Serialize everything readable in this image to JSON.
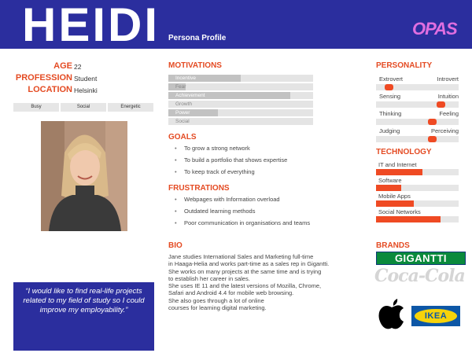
{
  "header": {
    "name": "HEIDI",
    "subtitle": "Persona Profile",
    "logo": "OPAS",
    "color": "#2b2e9e"
  },
  "facts": [
    {
      "label": "AGE",
      "value": "22"
    },
    {
      "label": "PROFESSION",
      "value": "Student"
    },
    {
      "label": "LOCATION",
      "value": "Helsinki"
    }
  ],
  "traits": [
    "Busy",
    "Social",
    "Energetic"
  ],
  "quote": "“I would like to find real-life projects related to my field of study so I could improve my employability.”",
  "motivations": {
    "title": "MOTIVATIONS",
    "items": [
      {
        "label": "Incentive",
        "level": 0.5
      },
      {
        "label": "Fear",
        "level": 0.12
      },
      {
        "label": "Achievement",
        "level": 0.84
      },
      {
        "label": "Growth",
        "level": 0.0
      },
      {
        "label": "Power",
        "level": 0.34
      },
      {
        "label": "Social",
        "level": 0.0
      }
    ]
  },
  "goals": {
    "title": "GOALS",
    "items": [
      "To grow a strong network",
      "To build a portfolio that shows expertise",
      "To keep track of everything"
    ]
  },
  "frustrations": {
    "title": "FRUSTRATIONS",
    "items": [
      "Webpages with Information overload",
      "Outdated learning methods",
      "Poor communication in organisations and teams"
    ]
  },
  "bio": {
    "title": "BIO",
    "lines": [
      "Jane studies International Sales and Marketing full-time",
      "in Haaga-Helia and works part-time as a sales rep in Gigantti.",
      "She works on many projects at the same time and is trying",
      "to establish her career in sales.",
      "She uses IE 11 and the latest versions of Mozilla, Chrome,",
      "Safari and Android 4.4 for mobile web browsing.",
      "She also goes through a lot of online",
      "courses for learning digital marketing."
    ]
  },
  "personality": {
    "title": "PERSONALITY",
    "scales": [
      {
        "left": "Extrovert",
        "right": "Introvert",
        "position": 0.12
      },
      {
        "left": "Sensing",
        "right": "Intuition",
        "position": 0.82
      },
      {
        "left": "Thinking",
        "right": "Feeling",
        "position": 0.7
      },
      {
        "left": "Judging",
        "right": "Perceiving",
        "position": 0.7
      }
    ]
  },
  "technology": {
    "title": "TECHNOLOGY",
    "items": [
      {
        "label": "IT and Internet",
        "level": 0.56
      },
      {
        "label": "Software",
        "level": 0.3
      },
      {
        "label": "Mobile Apps",
        "level": 0.46
      },
      {
        "label": "Social Networks",
        "level": 0.78
      }
    ]
  },
  "brands": {
    "title": "BRANDS",
    "items": [
      "GIGANTTI",
      "Coca-Cola",
      "Apple",
      "IKEA"
    ],
    "gigantti_text": "GIGANTTI",
    "cocacola_text": "Coca-Cola",
    "ikea_text": "IKEA"
  },
  "colors": {
    "accent": "#e44b23",
    "bar": "#ef4a23",
    "navy": "#2b2e9e"
  }
}
